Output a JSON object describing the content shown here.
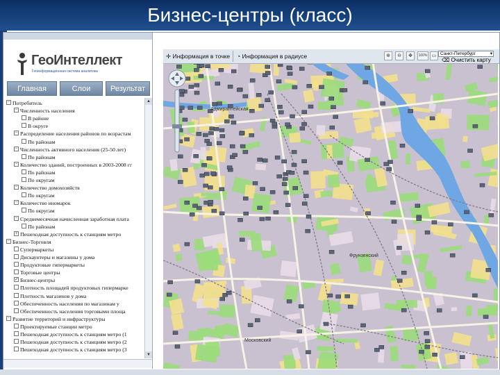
{
  "slide": {
    "title": "Бизнес-центры (класс)"
  },
  "logo": {
    "name": "ГеоИнтеллект",
    "subtitle": "Геоинформационная система аналитика"
  },
  "nav": {
    "tabs": [
      "Главная",
      "Слои",
      "Результат"
    ]
  },
  "tree": [
    {
      "indent": 0,
      "box": "−",
      "label": "Потребитель"
    },
    {
      "indent": 1,
      "box": "−",
      "label": "Численность населения"
    },
    {
      "indent": 2,
      "box": "",
      "label": "В районе"
    },
    {
      "indent": 2,
      "box": "",
      "label": "В округе"
    },
    {
      "indent": 1,
      "box": "−",
      "label": "Распределение населения районов по возрастам"
    },
    {
      "indent": 2,
      "box": "",
      "label": "По районам"
    },
    {
      "indent": 1,
      "box": "−",
      "label": "Численность активного населения (25-50 лет)"
    },
    {
      "indent": 2,
      "box": "",
      "label": "По районам"
    },
    {
      "indent": 1,
      "box": "−",
      "label": "Количество зданий, построенных в 2003-2008 гг"
    },
    {
      "indent": 2,
      "box": "",
      "label": "По районам"
    },
    {
      "indent": 2,
      "box": "",
      "label": "По округам"
    },
    {
      "indent": 1,
      "box": "−",
      "label": "Количество домохозяйств"
    },
    {
      "indent": 2,
      "box": "",
      "label": "По округам"
    },
    {
      "indent": 1,
      "box": "−",
      "label": "Количество иномарок"
    },
    {
      "indent": 2,
      "box": "",
      "label": "По округам"
    },
    {
      "indent": 1,
      "box": "−",
      "label": "Среднемесячная начисленная заработная плата"
    },
    {
      "indent": 2,
      "box": "",
      "label": "По районам"
    },
    {
      "indent": 1,
      "box": "+",
      "label": "Пешеходная доступность к станциям метро"
    },
    {
      "indent": 0,
      "box": "−",
      "label": "Бизнес-Торговля"
    },
    {
      "indent": 1,
      "box": "",
      "label": "Супермаркеты"
    },
    {
      "indent": 1,
      "box": "",
      "label": "Дискаунтеры и магазины у дома"
    },
    {
      "indent": 1,
      "box": "",
      "label": "Продуктовые гипермаркеты"
    },
    {
      "indent": 1,
      "box": "",
      "label": "Торговые центры"
    },
    {
      "indent": 1,
      "box": "✓",
      "label": "Бизнес-центры"
    },
    {
      "indent": 1,
      "box": "",
      "label": "Плотность площадей продуктовых гипермарке"
    },
    {
      "indent": 1,
      "box": "",
      "label": "Плотность магазинов у дома"
    },
    {
      "indent": 1,
      "box": "",
      "label": "Обеспеченность населения по магазинам у"
    },
    {
      "indent": 1,
      "box": "",
      "label": "Обеспеченность населения торговыми площа"
    },
    {
      "indent": 0,
      "box": "−",
      "label": "Развитие территорий и инфраструктуры"
    },
    {
      "indent": 1,
      "box": "",
      "label": "Проектируемые станции метро"
    },
    {
      "indent": 1,
      "box": "",
      "label": "Пешеходная доступность к станциям метро (1"
    },
    {
      "indent": 1,
      "box": "",
      "label": "Пешеходная доступность к станциям метро (2"
    },
    {
      "indent": 1,
      "box": "",
      "label": "Пешеходная доступность к станциям метро (3"
    }
  ],
  "toolbar": {
    "info_point": "Информация в точке",
    "info_radius": "Информация в радиусе",
    "city": "Санкт-Петербург",
    "clear_map": "Очистить карту",
    "zoom_label": "100%"
  },
  "map_labels": {
    "admiralty": "Адмиралтейская",
    "frunzensky": "Фрунзенский",
    "moskovsky": "Московский"
  },
  "colors": {
    "slide_header": "#17437f",
    "map_base": "#c9c1cf",
    "park": "#9bdc7a",
    "yellow": "#f2e08c",
    "water": "#6ea7e4",
    "marker": "#5b6577"
  }
}
